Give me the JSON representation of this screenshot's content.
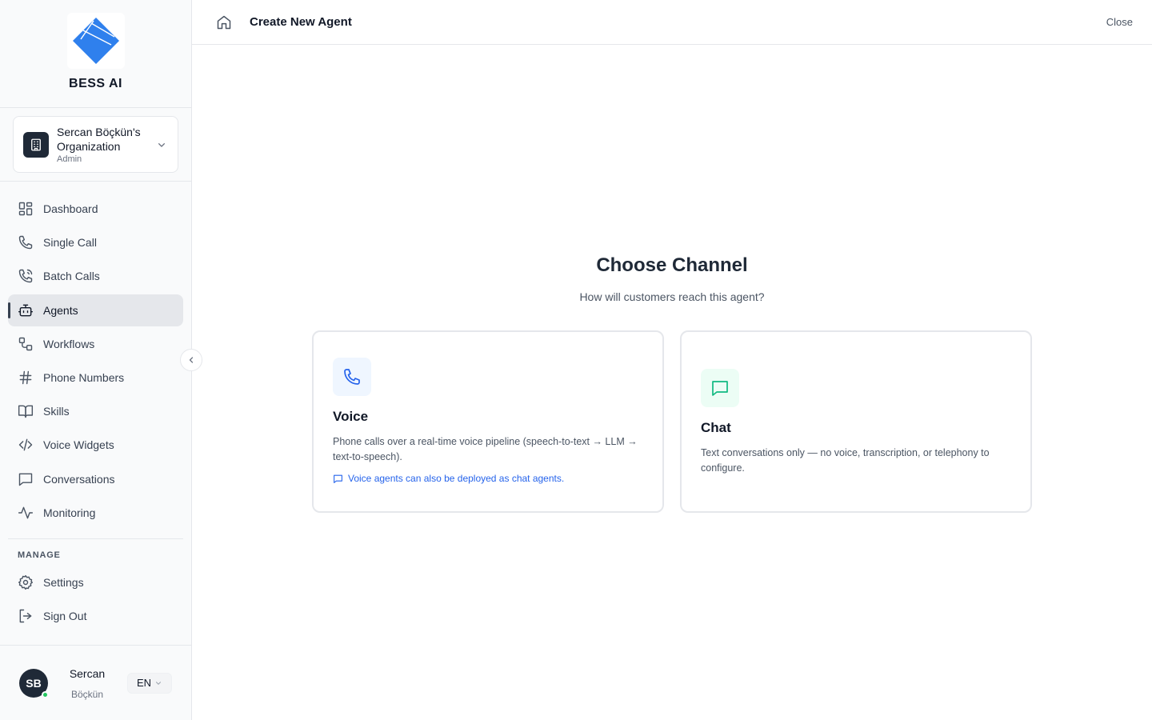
{
  "brand": {
    "name": "BESS AI"
  },
  "organization": {
    "name": "Sercan Böçkün's Organization",
    "role": "Admin"
  },
  "nav": [
    {
      "label": "Dashboard",
      "icon": "dashboard-icon"
    },
    {
      "label": "Single Call",
      "icon": "phone-icon"
    },
    {
      "label": "Batch Calls",
      "icon": "phone-calls-icon"
    },
    {
      "label": "Agents",
      "icon": "bot-icon",
      "active": true
    },
    {
      "label": "Workflows",
      "icon": "workflow-icon"
    },
    {
      "label": "Phone Numbers",
      "icon": "hash-icon"
    },
    {
      "label": "Skills",
      "icon": "book-icon"
    },
    {
      "label": "Voice Widgets",
      "icon": "code-icon"
    },
    {
      "label": "Conversations",
      "icon": "message-square-icon"
    },
    {
      "label": "Monitoring",
      "icon": "activity-icon"
    }
  ],
  "manage": {
    "label": "MANAGE",
    "items": [
      {
        "label": "Settings",
        "icon": "settings-icon"
      },
      {
        "label": "Sign Out",
        "icon": "sign-out-icon"
      }
    ]
  },
  "user": {
    "initials": "SB",
    "first_name": "Sercan",
    "last_name": "Böçkün",
    "status": "online",
    "language": "EN"
  },
  "header": {
    "title": "Create New Agent",
    "close_label": "Close"
  },
  "main": {
    "title": "Choose Channel",
    "subtitle": "How will customers reach this agent?",
    "cards": {
      "voice": {
        "title": "Voice",
        "description": "Phone calls over a real-time voice pipeline (speech-to-text → LLM → text-to-speech).",
        "note": "Voice agents can also be deployed as chat agents.",
        "icon": "phone-icon",
        "accent": "#2563eb"
      },
      "chat": {
        "title": "Chat",
        "description": "Text conversations only — no voice, transcription, or telephony to configure.",
        "icon": "message-square-icon",
        "accent": "#10b981"
      }
    }
  },
  "colors": {
    "active_bg": "#e5e7eb",
    "logo_blue": "#2f80ed",
    "text_dark": "#111827"
  }
}
